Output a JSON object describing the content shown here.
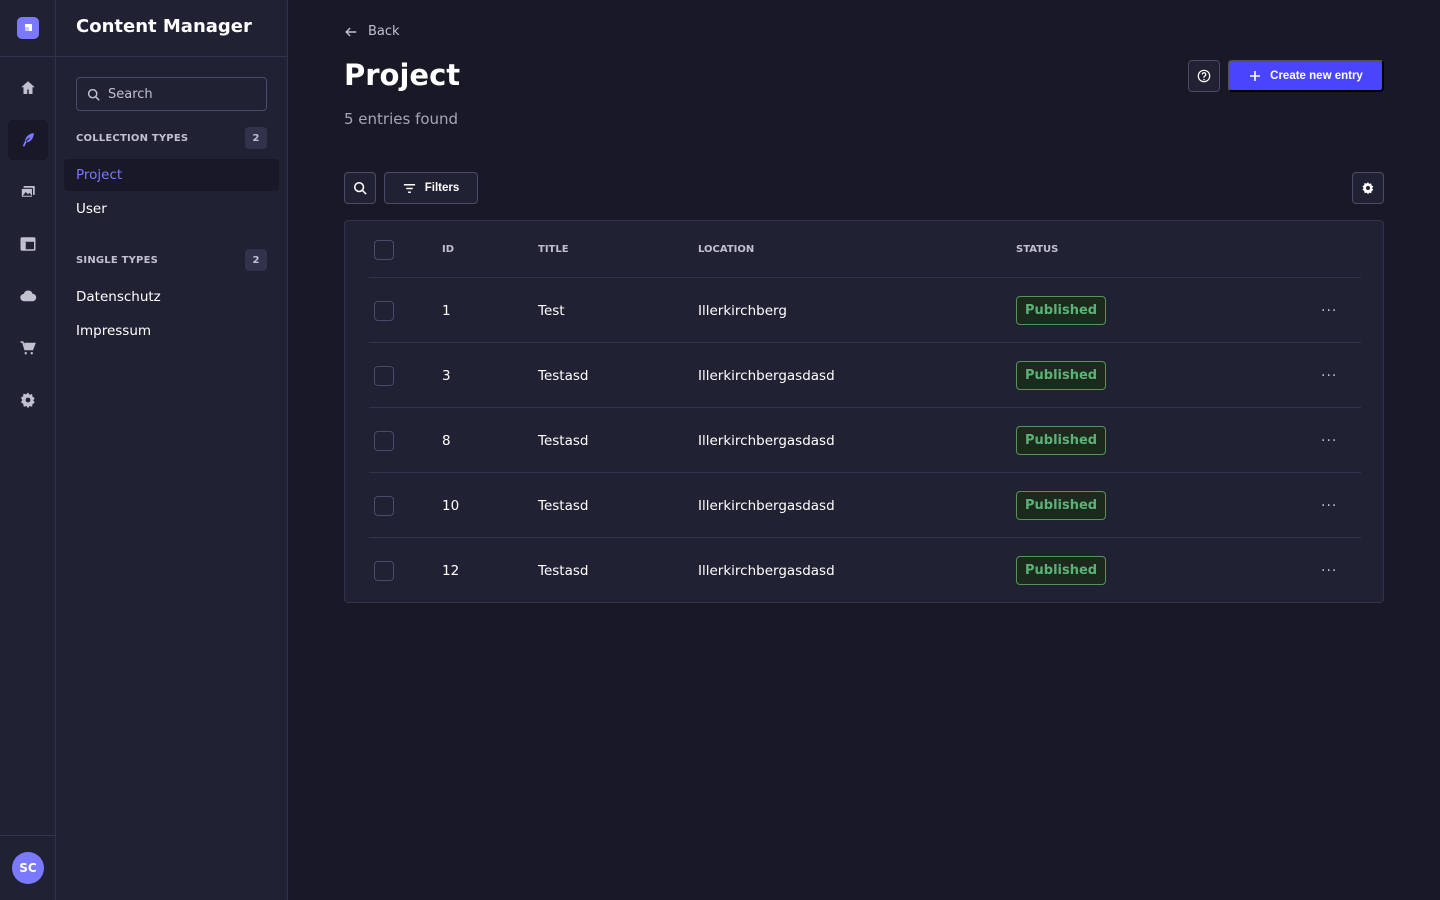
{
  "colors": {
    "accent": "#4945ff",
    "accent_light": "#7b79ff",
    "success": "#5cb176",
    "background": "#181826",
    "surface": "#212134"
  },
  "rail": {
    "logo_icon": "strapi-logo-icon",
    "items": [
      {
        "icon": "home-icon"
      },
      {
        "icon": "feather-icon",
        "active": true
      },
      {
        "icon": "media-library-icon"
      },
      {
        "icon": "layout-icon"
      },
      {
        "icon": "cloud-icon"
      },
      {
        "icon": "cart-icon"
      },
      {
        "icon": "gear-icon"
      }
    ],
    "avatar_initials": "SC"
  },
  "subnav": {
    "title": "Content Manager",
    "search_placeholder": "Search",
    "collection_types": {
      "label": "COLLECTION TYPES",
      "count": "2",
      "items": [
        "Project",
        "User"
      ]
    },
    "single_types": {
      "label": "SINGLE TYPES",
      "count": "2",
      "items": [
        "Datenschutz",
        "Impressum"
      ]
    }
  },
  "header": {
    "back_label": "Back",
    "title": "Project",
    "subtitle": "5 entries found",
    "create_label": "Create new entry"
  },
  "toolbar": {
    "filters_label": "Filters"
  },
  "table": {
    "columns": [
      "ID",
      "TITLE",
      "LOCATION",
      "STATUS"
    ],
    "rows": [
      {
        "id": "1",
        "title": "Test",
        "location": "Illerkirchberg",
        "status": "Published"
      },
      {
        "id": "3",
        "title": "Testasd",
        "location": "Illerkirchbergasdasd",
        "status": "Published"
      },
      {
        "id": "8",
        "title": "Testasd",
        "location": "Illerkirchbergasdasd",
        "status": "Published"
      },
      {
        "id": "10",
        "title": "Testasd",
        "location": "Illerkirchbergasdasd",
        "status": "Published"
      },
      {
        "id": "12",
        "title": "Testasd",
        "location": "Illerkirchbergasdasd",
        "status": "Published"
      }
    ],
    "row_actions_label": "···"
  }
}
